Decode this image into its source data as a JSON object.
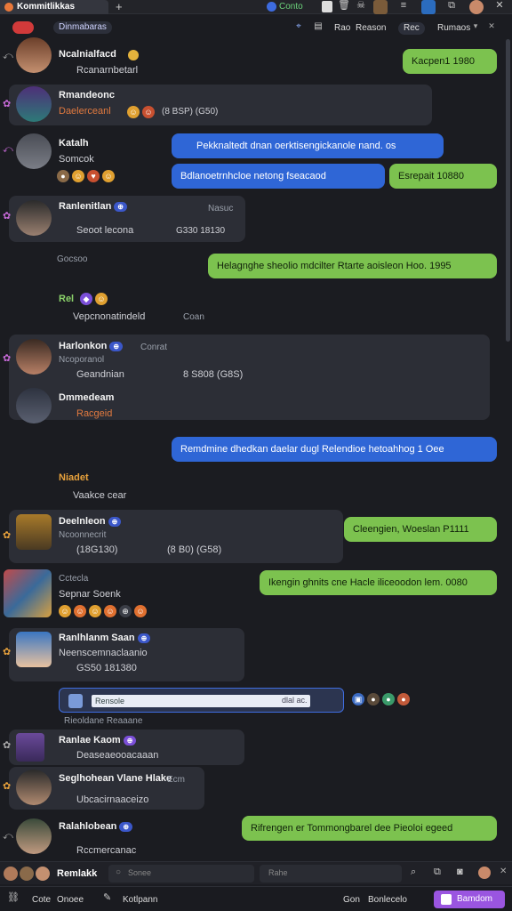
{
  "window": {
    "tab_title": "Kommitlikkas",
    "add_tab": "+",
    "status_label": "Conto"
  },
  "toolbar": {
    "channel_label": "Dinmabaras",
    "btn_rec": "Rec",
    "btn_sort": "Rao",
    "btn_reason": "Reason",
    "btn_members": "Rumaos"
  },
  "messages": [
    {
      "name": "Ncalnialfacd",
      "sub": "Rcanarnbetarl"
    },
    {
      "name": "Rmandeonc",
      "sub": "Daelerceanl",
      "meta": "(8 BSP) (G50)"
    },
    {
      "name": "Katalh",
      "sub": "Somcok"
    },
    {
      "name": "Ranlenitlan",
      "sub": "Seoot lecona",
      "meta": "G330 18130",
      "aside": "Nasuc"
    },
    {
      "name": "Rel",
      "sub": "Vepcnonatindeld",
      "meta": "Coan"
    },
    {
      "name": "Harlonkon",
      "sub": "Ncoporanol",
      "meta": "Conrat",
      "meta2": "Geandnian",
      "meta3": "8 S808 (G8S)"
    },
    {
      "name": "Dmmedeam",
      "sub": "Racgeid"
    },
    {
      "name": "Niadet",
      "sub": "Vaakce cear"
    },
    {
      "name": "Deelnleon",
      "sub": "Ncoonnecrit",
      "meta": "(18G130)",
      "meta2": "(8 B0) (G58)"
    },
    {
      "name": "Cctecla",
      "sub": "Sepnar Soenk"
    },
    {
      "name": "Ranlhlanm Saan",
      "sub": "Neenscemnaclaanio",
      "meta": "GS50 181380"
    },
    {
      "name": "Ranlae Kaom",
      "sub": "Deaseaeooacaaan"
    },
    {
      "name": "Seglhohean Vlane Hlake",
      "sub": "Ubcacirnaaceizo",
      "meta": "Ecm"
    },
    {
      "name": "Ralahlobean",
      "sub": "Rccmercanac"
    }
  ],
  "outgoing": [
    {
      "text": "Kacpen1 1980",
      "style": "green"
    },
    {
      "text": "Pekknaltedt dnan oerktisengickanole nand. os",
      "style": "blue"
    },
    {
      "text": "Bdlanoetrnhcloe netong fseacaod",
      "style": "blue"
    },
    {
      "text": "Esrepait 10880",
      "style": "green"
    },
    {
      "text": "Helagnghe sheolio mdcilter Rtarte aoisleon Hoo. 1995",
      "style": "green"
    },
    {
      "text": "Remdmine dhedkan daelar dugl Relendioe hetoahhog 1 Oee",
      "style": "blue"
    },
    {
      "text": "Cleengien, Woeslan P1111",
      "style": "green"
    },
    {
      "text": "Ikengin ghnits cne Hacle iliceoodon lem. 0080",
      "style": "green"
    },
    {
      "text": "Rifrengen er Tommongbarel dee Pieoloi egeed",
      "style": "green"
    }
  ],
  "date_dividers": [
    "Gocsoo",
    "Rieoldane Reaaane"
  ],
  "quote_box": {
    "text": "Rensole",
    "right": "dlal ac."
  },
  "composer": {
    "sender": "Remlakk",
    "placeholder": "Sonee",
    "input_right": "Rahe"
  },
  "statusbar": {
    "left1": "Cote",
    "left2": "Onoee",
    "left3": "Kotlpann",
    "right1": "Gon",
    "right2": "Bonlecelo",
    "cta": "Bamdom"
  },
  "colors": {
    "bg": "#1b1c21",
    "bubble_dark": "#2c2e36",
    "bubble_blue": "#2f66d6",
    "bubble_green": "#7cc24f",
    "accent_purple": "#9a55e0"
  }
}
